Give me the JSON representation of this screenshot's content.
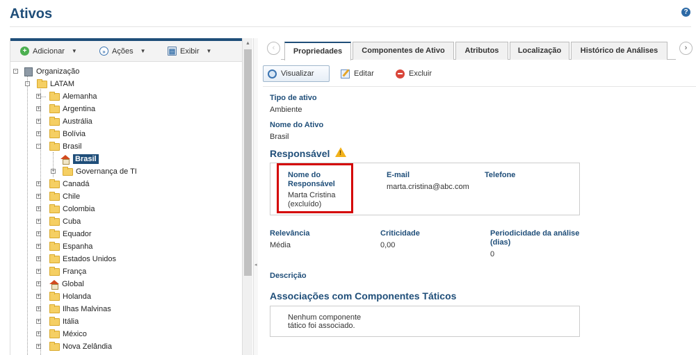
{
  "page": {
    "title": "Ativos",
    "help_icon": "question-circle-icon"
  },
  "tree_toolbar": {
    "add_label": "Adicionar",
    "actions_label": "Ações",
    "view_label": "Exibir"
  },
  "tree": {
    "root": "Organização",
    "latam": "LATAM",
    "items": [
      "Alemanha",
      "Argentina",
      "Austrália",
      "Bolívia",
      "Brasil",
      "Canadá",
      "Chile",
      "Colombia",
      "Cuba",
      "Equador",
      "Espanha",
      "Estados Unidos",
      "França",
      "Global",
      "Holanda",
      "Ilhas Malvinas",
      "Itália",
      "México",
      "Nova Zelândia"
    ],
    "brasil_children": {
      "selected": "Brasil",
      "governance": "Governança de TI"
    }
  },
  "tabs": [
    "Propriedades",
    "Componentes de Ativo",
    "Atributos",
    "Localização",
    "Histórico de Análises"
  ],
  "actions": {
    "view": "Visualizar",
    "edit": "Editar",
    "delete": "Excluir"
  },
  "properties": {
    "asset_type_label": "Tipo de ativo",
    "asset_type_value": "Ambiente",
    "asset_name_label": "Nome do Ativo",
    "asset_name_value": "Brasil",
    "responsible_title": "Responsável",
    "resp_name_label_1": "Nome do",
    "resp_name_label_2": "Responsável",
    "resp_name_value_1": "Marta Cristina",
    "resp_name_value_2": "(excluído)",
    "email_label": "E-mail",
    "email_value": "marta.cristina@abc.com",
    "phone_label": "Telefone",
    "relevance_label": "Relevância",
    "relevance_value": "Média",
    "criticality_label": "Criticidade",
    "criticality_value": "0,00",
    "periodicity_label_1": "Periodicidade da análise",
    "periodicity_label_2": "(dias)",
    "periodicity_value": "0",
    "description_label": "Descrição",
    "assoc_title": "Associações com Componentes Táticos",
    "assoc_empty_1": "Nenhum componente",
    "assoc_empty_2": "tático foi associado."
  },
  "colors": {
    "brand": "#1f4e79",
    "highlight": "#d40000",
    "warning": "#f2b21b"
  }
}
